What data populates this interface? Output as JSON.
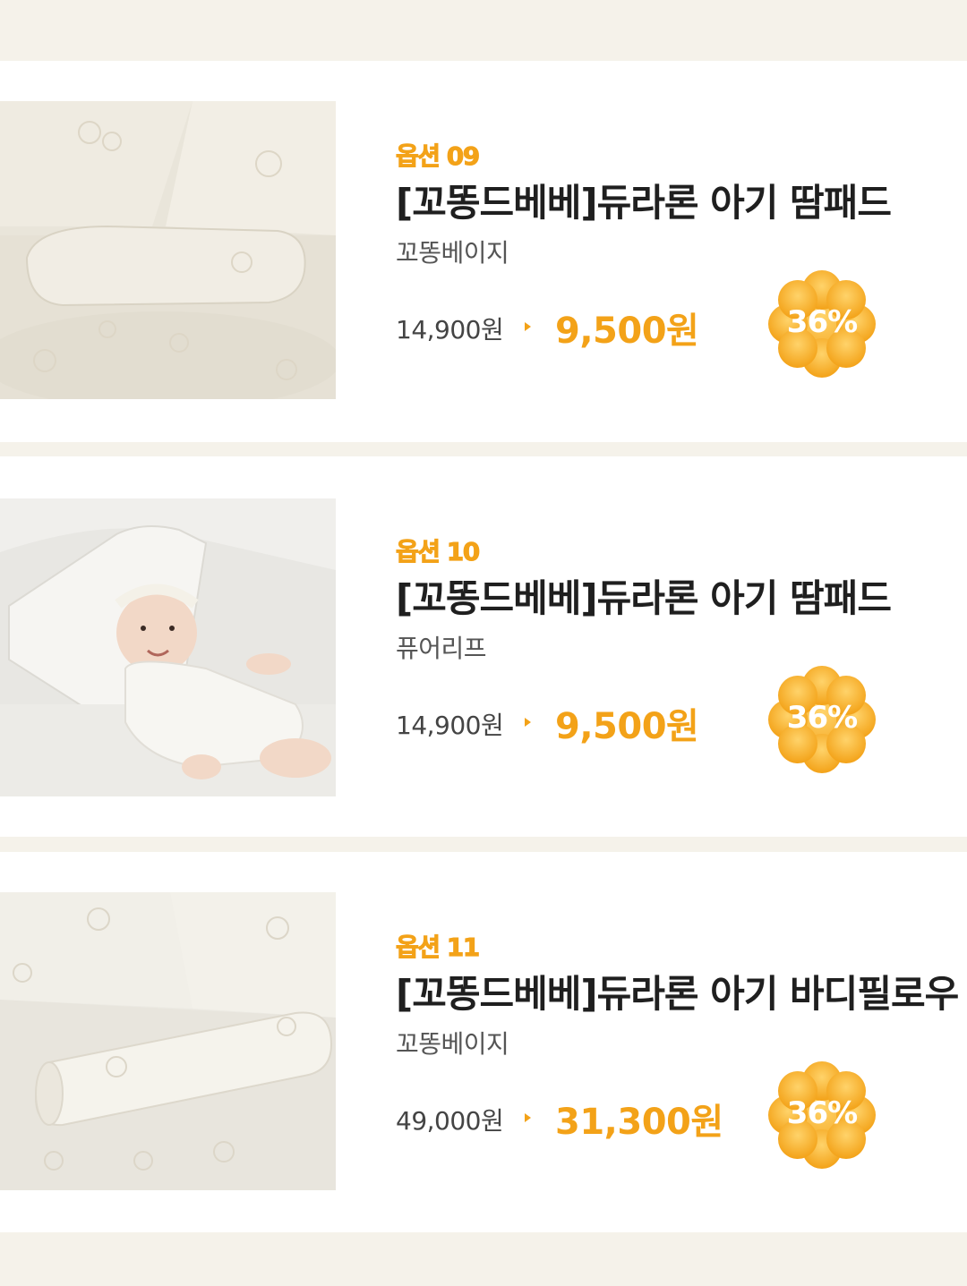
{
  "products": [
    {
      "option": "옵션 09",
      "title": "[꼬똥드베베]듀라론 아기 땀패드",
      "variant": "꼬똥베이지",
      "original_price": "14,900원",
      "sale_price": "9,500원",
      "discount": "36%"
    },
    {
      "option": "옵션 10",
      "title": "[꼬똥드베베]듀라론 아기 땀패드",
      "variant": "퓨어리프",
      "original_price": "14,900원",
      "sale_price": "9,500원",
      "discount": "36%"
    },
    {
      "option": "옵션 11",
      "title": "[꼬똥드베베]듀라론 아기 바디필로우",
      "variant": "꼬똥베이지",
      "original_price": "49,000원",
      "sale_price": "31,300원",
      "discount": "36%"
    }
  ],
  "colors": {
    "accent": "#f3a218",
    "background": "#f5f2ea",
    "card": "#ffffff"
  }
}
